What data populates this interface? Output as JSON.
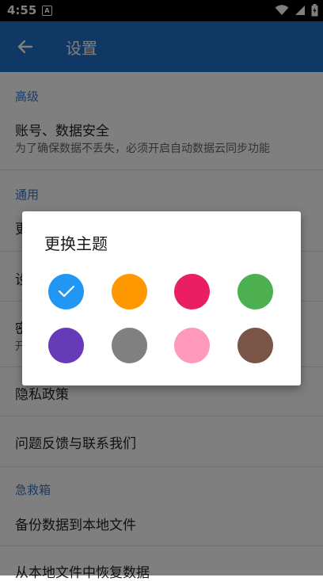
{
  "status_bar": {
    "time": "4:55",
    "notification_icon": "A"
  },
  "app_bar": {
    "title": "设置",
    "back_icon": "arrow-left-icon"
  },
  "settings": {
    "advanced_header": "高级",
    "account_title": "账号、数据安全",
    "account_subtitle": "为了确保数据不丢失，必须开启自动数据云同步功能",
    "general_header": "通用",
    "theme_title_partial": "更",
    "setting2_partial": "设",
    "password_title_partial": "密",
    "password_sub_partial": "开",
    "privacy_title": "隐私政策",
    "feedback_title": "问题反馈与联系我们",
    "rescue_header": "急救箱",
    "backup_title": "备份数据到本地文件",
    "restore_title": "从本地文件中恢复数据"
  },
  "theme_dialog": {
    "title": "更换主题",
    "selected_index": 0,
    "colors": [
      "#2196f3",
      "#ff9800",
      "#e91e63",
      "#4caf50",
      "#673ab7",
      "#808080",
      "#ff99bb",
      "#795548"
    ]
  }
}
